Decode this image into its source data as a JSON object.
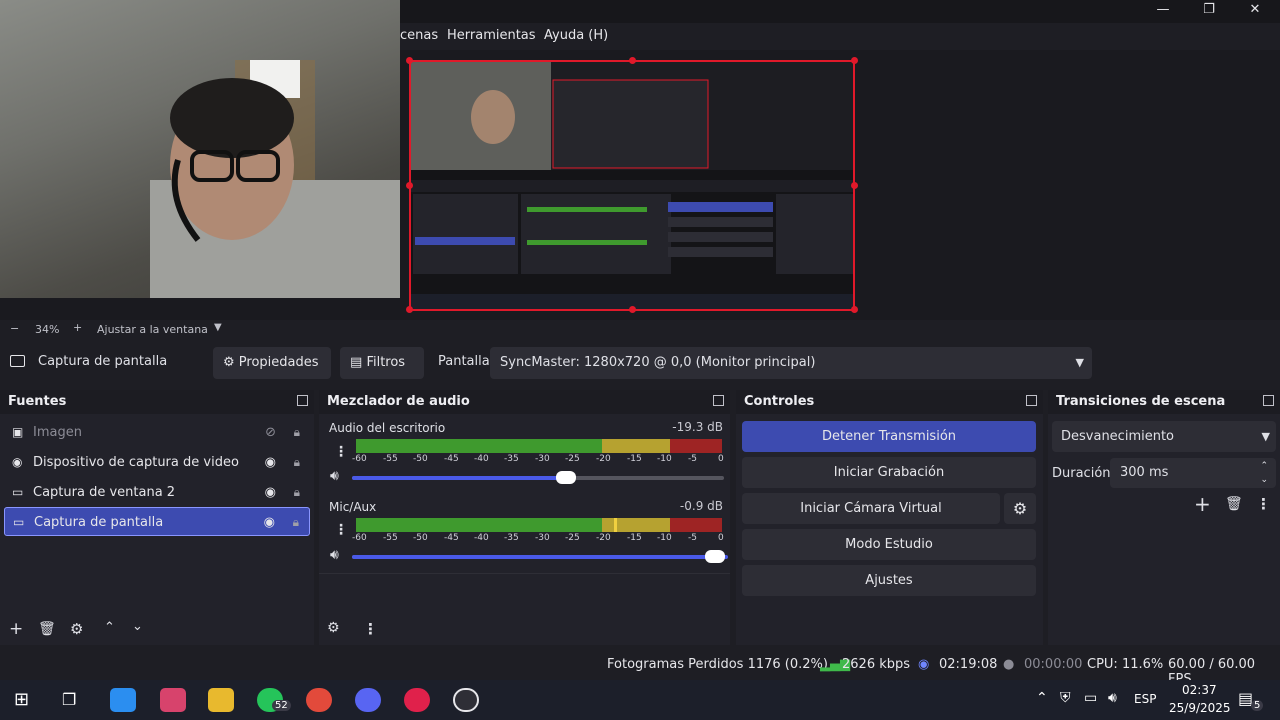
{
  "window": {
    "menu": [
      "cenas",
      "Herramientas",
      "Ayuda (H)"
    ],
    "controls": [
      "—",
      "❐",
      "✕"
    ]
  },
  "zoom": {
    "minus": "−",
    "level": "34%",
    "plus": "+",
    "fit": "Ajustar a la ventana"
  },
  "source_toolbar": {
    "selected_source": "Captura de pantalla",
    "properties": "Propiedades",
    "filters": "Filtros",
    "display_label": "Pantalla",
    "display_value": "SyncMaster: 1280x720 @ 0,0 (Monitor principal)"
  },
  "sources": {
    "title": "Fuentes",
    "items": [
      {
        "label": "Imagen",
        "icon": "image-icon",
        "visible": false
      },
      {
        "label": "Dispositivo de captura de video",
        "icon": "camera-icon",
        "visible": true
      },
      {
        "label": "Captura de ventana 2",
        "icon": "window-icon",
        "visible": true
      },
      {
        "label": "Captura de pantalla",
        "icon": "monitor-icon",
        "visible": true,
        "selected": true
      }
    ]
  },
  "mixer": {
    "title": "Mezclador de audio",
    "scale": [
      "-60",
      "-55",
      "-50",
      "-45",
      "-40",
      "-35",
      "-30",
      "-25",
      "-20",
      "-15",
      "-10",
      "-5",
      "0"
    ],
    "channels": [
      {
        "name": "Audio del escritorio",
        "db": "-19.3 dB",
        "level": 0.9
      },
      {
        "name": "Mic/Aux",
        "db": "-0.9 dB",
        "level": 0.95
      }
    ]
  },
  "controls": {
    "title": "Controles",
    "stop_stream": "Detener Transmisión",
    "start_recording": "Iniciar Grabación",
    "start_virtual_cam": "Iniciar Cámara Virtual",
    "studio_mode": "Modo Estudio",
    "settings": "Ajustes"
  },
  "transitions": {
    "title": "Transiciones de escena",
    "selected": "Desvanecimiento",
    "duration_label": "Duración",
    "duration_value": "300 ms"
  },
  "status": {
    "dropped_frames": "Fotogramas Perdidos 1176 (0.2%)",
    "bitrate": "2626 kbps",
    "stream_time": "02:19:08",
    "rec_time": "00:00:00",
    "cpu": "CPU: 11.6%",
    "fps": "60.00 / 60.00 FPS"
  },
  "taskbar": {
    "whatsapp_badge": "52",
    "lang": "ESP",
    "time": "02:37",
    "date": "25/9/2025",
    "notif_count": "5"
  },
  "colors": {
    "accent": "#3d4bb0",
    "red": "#e0192a",
    "meter_green": "#3f9a2e",
    "meter_yellow": "#b6a230",
    "meter_red": "#9e2424"
  }
}
